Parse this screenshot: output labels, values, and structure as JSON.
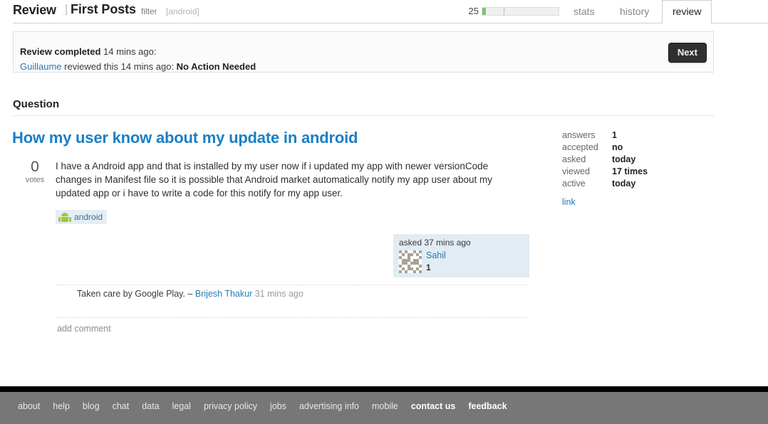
{
  "header": {
    "title": "Review",
    "separator": "|",
    "subtitle": "First Posts",
    "filter_label": "filter",
    "filter_tag": "[android]",
    "progress_count": "25",
    "progress_percent": 5,
    "tick_percent": 28,
    "accent_green": "#7cc576",
    "tabs": [
      {
        "label": "stats",
        "active": false
      },
      {
        "label": "history",
        "active": false
      },
      {
        "label": "review",
        "active": true
      }
    ]
  },
  "banner": {
    "completed_label": "Review completed",
    "completed_time": " 14 mins ago:",
    "reviewer": "Guillaume",
    "reviewed_text": " reviewed this 14 mins ago: ",
    "verdict": "No Action Needed",
    "next_label": "Next"
  },
  "question": {
    "section_heading": "Question",
    "title": "How my user know about my update in android",
    "vote_count": "0",
    "vote_label": "votes",
    "body": "I have a Android app and that is installed by my user now if i updated my app with newer versionCode changes in Manifest file so it is possible that Android market automatically notify my app user about my updated app or i have to write a code for this notify for my app user.",
    "tags": [
      "android"
    ],
    "asked_card": {
      "when": "asked 37 mins ago",
      "user": "Sahil",
      "reputation": "1"
    },
    "comments": [
      {
        "text": "Taken care by Google Play.",
        "dash": "–",
        "user": "Brijesh Thakur",
        "when": "31 mins ago"
      }
    ],
    "add_comment_label": "add comment"
  },
  "stats_rail": {
    "rows": [
      {
        "key": "answers",
        "value": "1"
      },
      {
        "key": "accepted",
        "value": "no"
      },
      {
        "key": "asked",
        "value": "today"
      },
      {
        "key": "viewed",
        "value": "17 times"
      },
      {
        "key": "active",
        "value": "today"
      }
    ],
    "link_label": "link"
  },
  "footer": {
    "links": [
      {
        "label": "about",
        "strong": false
      },
      {
        "label": "help",
        "strong": false
      },
      {
        "label": "blog",
        "strong": false
      },
      {
        "label": "chat",
        "strong": false
      },
      {
        "label": "data",
        "strong": false
      },
      {
        "label": "legal",
        "strong": false
      },
      {
        "label": "privacy policy",
        "strong": false
      },
      {
        "label": "jobs",
        "strong": false
      },
      {
        "label": "advertising info",
        "strong": false
      },
      {
        "label": "mobile",
        "strong": false
      },
      {
        "label": "contact us",
        "strong": true
      },
      {
        "label": "feedback",
        "strong": true
      }
    ]
  }
}
